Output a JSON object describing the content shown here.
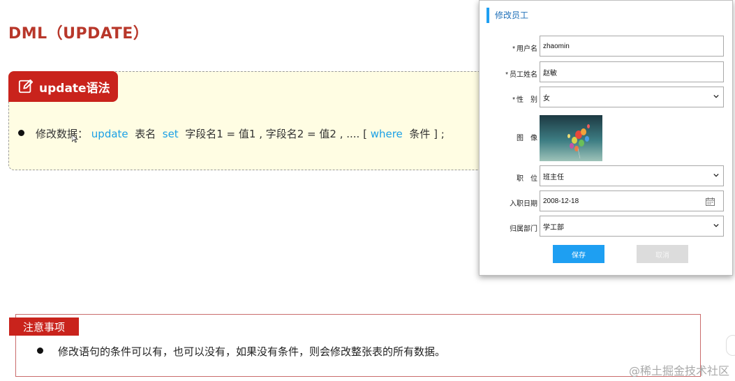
{
  "slide": {
    "title": "DML（UPDATE）",
    "syntax_tag": "update语法",
    "syntax_line": {
      "prefix": "修改数据：",
      "kw_update": "update",
      "table": "表名",
      "kw_set": "set",
      "assign": "字段名1 = 值1 , 字段名2 = 值2 , .... [",
      "kw_where": "where",
      "suffix": "条件 ] ;"
    },
    "notes_tag": "注意事项",
    "notes_text": "修改语句的条件可以有，也可以没有，如果没有条件，则会修改整张表的所有数据。",
    "watermark": "@稀土掘金技术社区"
  },
  "dialog": {
    "title": "修改员工",
    "fields": {
      "username": {
        "label": "用户名",
        "required": "*",
        "value": "zhaomin"
      },
      "name": {
        "label": "员工姓名",
        "required": "*",
        "value": "赵敏"
      },
      "gender": {
        "label": "性　别",
        "required": "*",
        "value": "女"
      },
      "image": {
        "label": "图　像"
      },
      "job": {
        "label": "职　位",
        "value": "班主任"
      },
      "entry_date": {
        "label": "入职日期",
        "value": "2008-12-18"
      },
      "dept": {
        "label": "归属部门",
        "value": "学工部"
      }
    },
    "save_label": "保存",
    "cancel_label": "取消"
  },
  "colors": {
    "accent_red": "#c9231c",
    "title_red": "#b8372a",
    "keyword_blue": "#1aa0e6",
    "primary_blue": "#1e9ff2",
    "syntax_bg": "#fffde3"
  },
  "icons": [
    "edit-icon",
    "chevron-down-icon",
    "calendar-icon",
    "cursor-icon"
  ]
}
